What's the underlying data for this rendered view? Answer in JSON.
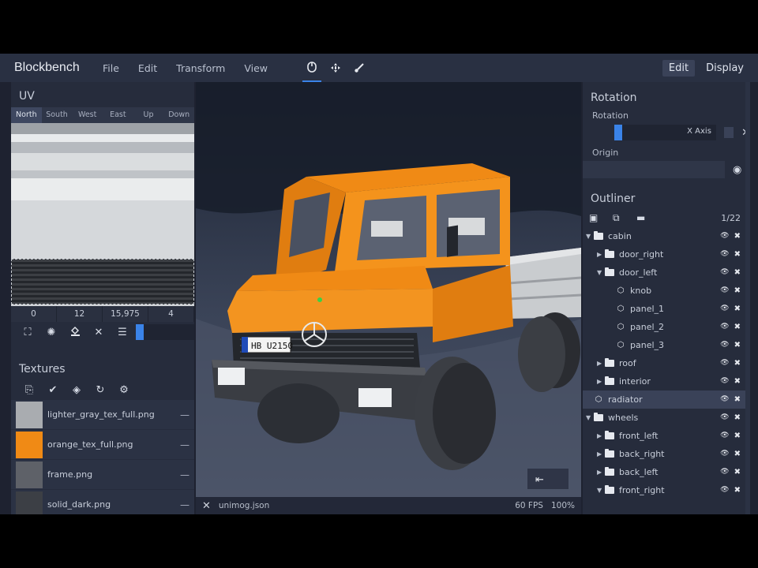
{
  "app": {
    "brand": "Blockbench",
    "menu": [
      "File",
      "Edit",
      "Transform",
      "View"
    ],
    "modes": [
      "Edit",
      "Display"
    ],
    "active_mode": "Edit",
    "tools": [
      "mouse-icon",
      "move-icon",
      "brush-icon"
    ]
  },
  "uv": {
    "title": "UV",
    "faces": [
      "North",
      "South",
      "West",
      "East",
      "Up",
      "Down"
    ],
    "active_face": "North",
    "values": [
      "0",
      "12",
      "15,975",
      "4"
    ]
  },
  "textures": {
    "title": "Textures",
    "items": [
      {
        "name": "lighter_gray_tex_full.png",
        "color": "#a9acb0"
      },
      {
        "name": "orange_tex_full.png",
        "color": "#f08a15"
      },
      {
        "name": "frame.png",
        "color": "#5e6168"
      },
      {
        "name": "solid_dark.png",
        "color": "#3c3f45"
      }
    ]
  },
  "viewport": {
    "filename": "unimog.json",
    "fps": "60 FPS",
    "zoom": "100%",
    "plate": "HB U2150"
  },
  "rotation": {
    "title": "Rotation",
    "label": "Rotation",
    "axis": "X Axis",
    "origin_label": "Origin"
  },
  "outliner": {
    "title": "Outliner",
    "count": "1/22",
    "rows": [
      {
        "label": "cabin",
        "type": "folder",
        "depth": 0,
        "expanded": true
      },
      {
        "label": "door_right",
        "type": "folder",
        "depth": 1,
        "expanded": false
      },
      {
        "label": "door_left",
        "type": "folder",
        "depth": 1,
        "expanded": true
      },
      {
        "label": "knob",
        "type": "cube",
        "depth": 2
      },
      {
        "label": "panel_1",
        "type": "cube",
        "depth": 2
      },
      {
        "label": "panel_2",
        "type": "cube",
        "depth": 2
      },
      {
        "label": "panel_3",
        "type": "cube",
        "depth": 2
      },
      {
        "label": "roof",
        "type": "folder",
        "depth": 1,
        "expanded": false
      },
      {
        "label": "interior",
        "type": "folder",
        "depth": 1,
        "expanded": false
      },
      {
        "label": "radiator",
        "type": "cube",
        "depth": 0,
        "selected": true
      },
      {
        "label": "wheels",
        "type": "folder",
        "depth": 0,
        "expanded": true
      },
      {
        "label": "front_left",
        "type": "folder",
        "depth": 1,
        "expanded": false
      },
      {
        "label": "back_right",
        "type": "folder",
        "depth": 1,
        "expanded": false
      },
      {
        "label": "back_left",
        "type": "folder",
        "depth": 1,
        "expanded": false
      },
      {
        "label": "front_right",
        "type": "folder",
        "depth": 1,
        "expanded": true
      }
    ]
  }
}
